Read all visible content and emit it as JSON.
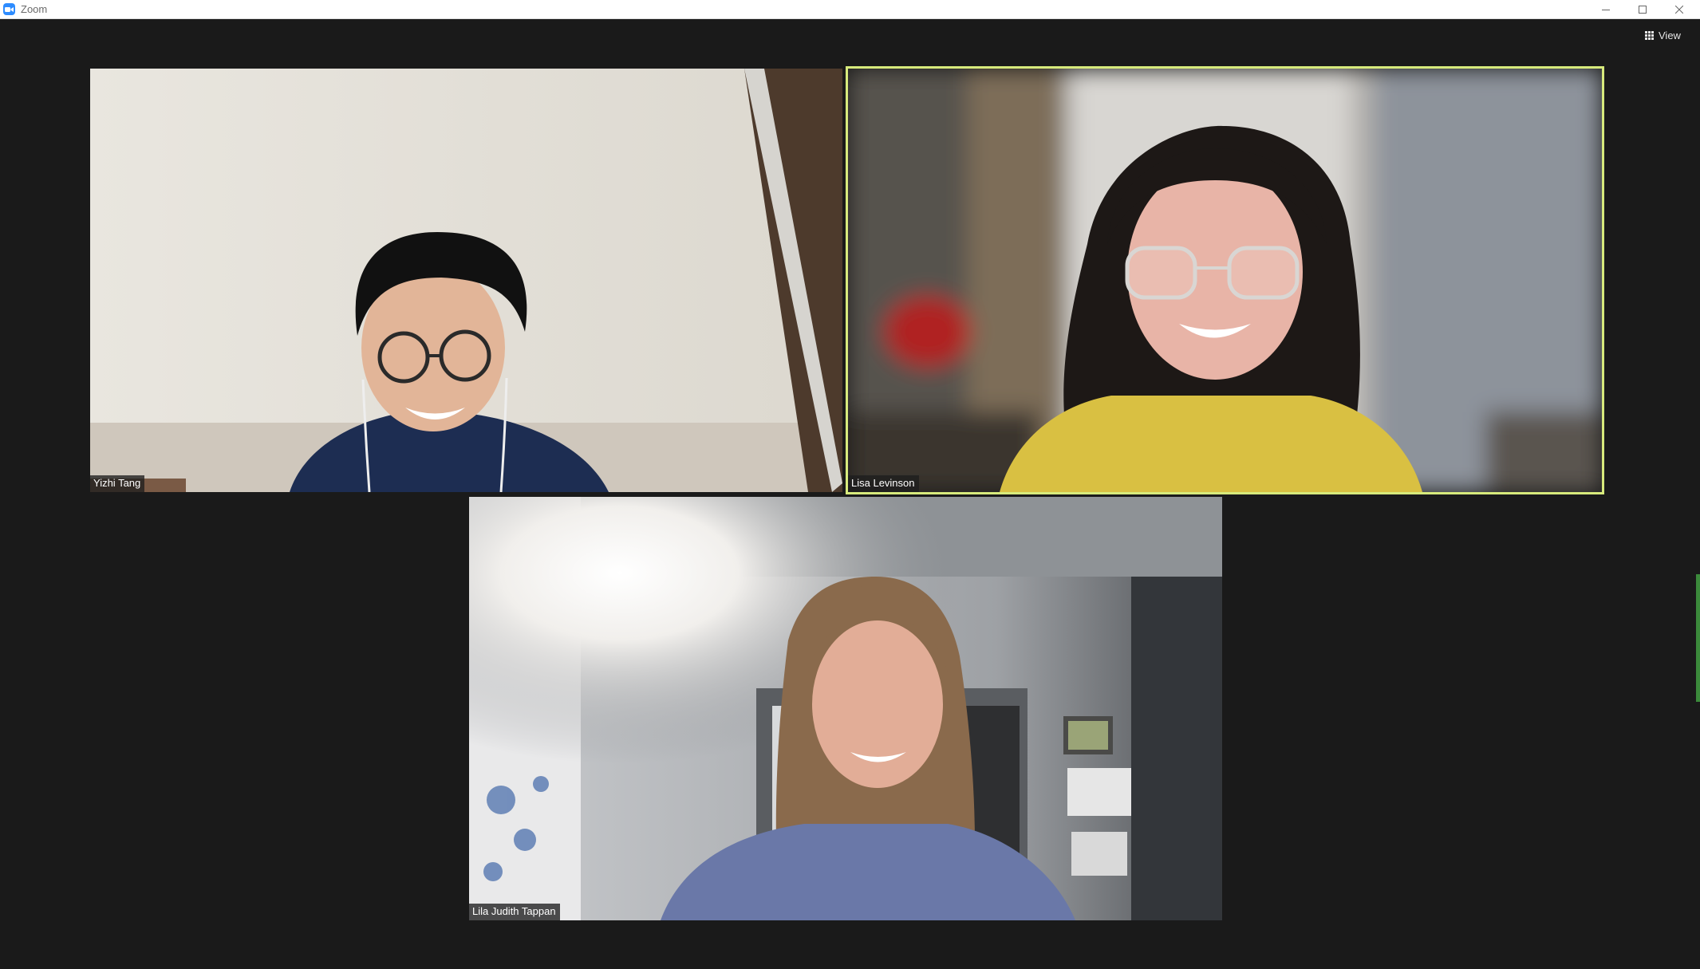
{
  "window": {
    "title": "Zoom",
    "icon": "zoom-app-icon",
    "controls": [
      "minimize-icon",
      "maximize-icon",
      "close-icon"
    ]
  },
  "toolbar": {
    "view_label": "View",
    "view_icon": "grid-icon"
  },
  "participants": [
    {
      "name": "Yizhi Tang",
      "active_speaker": false
    },
    {
      "name": "Lisa Levinson",
      "active_speaker": true
    },
    {
      "name": "Lila Judith Tappan",
      "active_speaker": false
    }
  ],
  "colors": {
    "background": "#1a1a1a",
    "active_speaker_border": "#d7ea7c",
    "zoom_blue": "#2d8cff"
  }
}
